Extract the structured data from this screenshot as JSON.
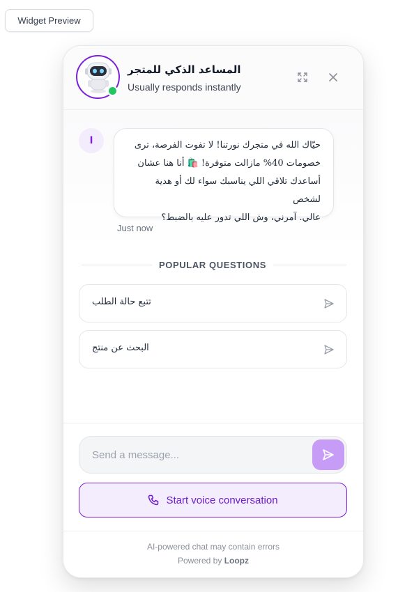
{
  "preview": {
    "label": "Widget Preview"
  },
  "header": {
    "title": "المساعد الذكي للمتجر",
    "status": "Usually responds instantly"
  },
  "message": {
    "avatar_letter": "ا",
    "lines": [
      "حيّاك الله في متجرك نورتنا! لا تفوت الفرصة، ترى",
      "خصومات 40% مازالت متوفرة! 🛍️ أنا هنا عشان",
      "أساعدك تلاقي اللي يناسبك سواء لك أو هدية لشخص",
      "عالي. آمرني، وش اللي تدور عليه بالضبط؟"
    ],
    "time": "Just now"
  },
  "popular": {
    "title": "POPULAR QUESTIONS",
    "items": [
      {
        "label": "تتبع حالة الطلب"
      },
      {
        "label": "البحث عن منتج"
      }
    ]
  },
  "composer": {
    "placeholder": "Send a message..."
  },
  "voice": {
    "label": "Start voice conversation"
  },
  "footer": {
    "note": "AI-powered chat may contain errors",
    "powered_prefix": "Powered by",
    "powered_brand": "Loopz"
  },
  "colors": {
    "accent": "#7c1fd9",
    "send_button": "#c79cf6",
    "voice_bg": "#f4edfe",
    "online": "#22c55e"
  }
}
